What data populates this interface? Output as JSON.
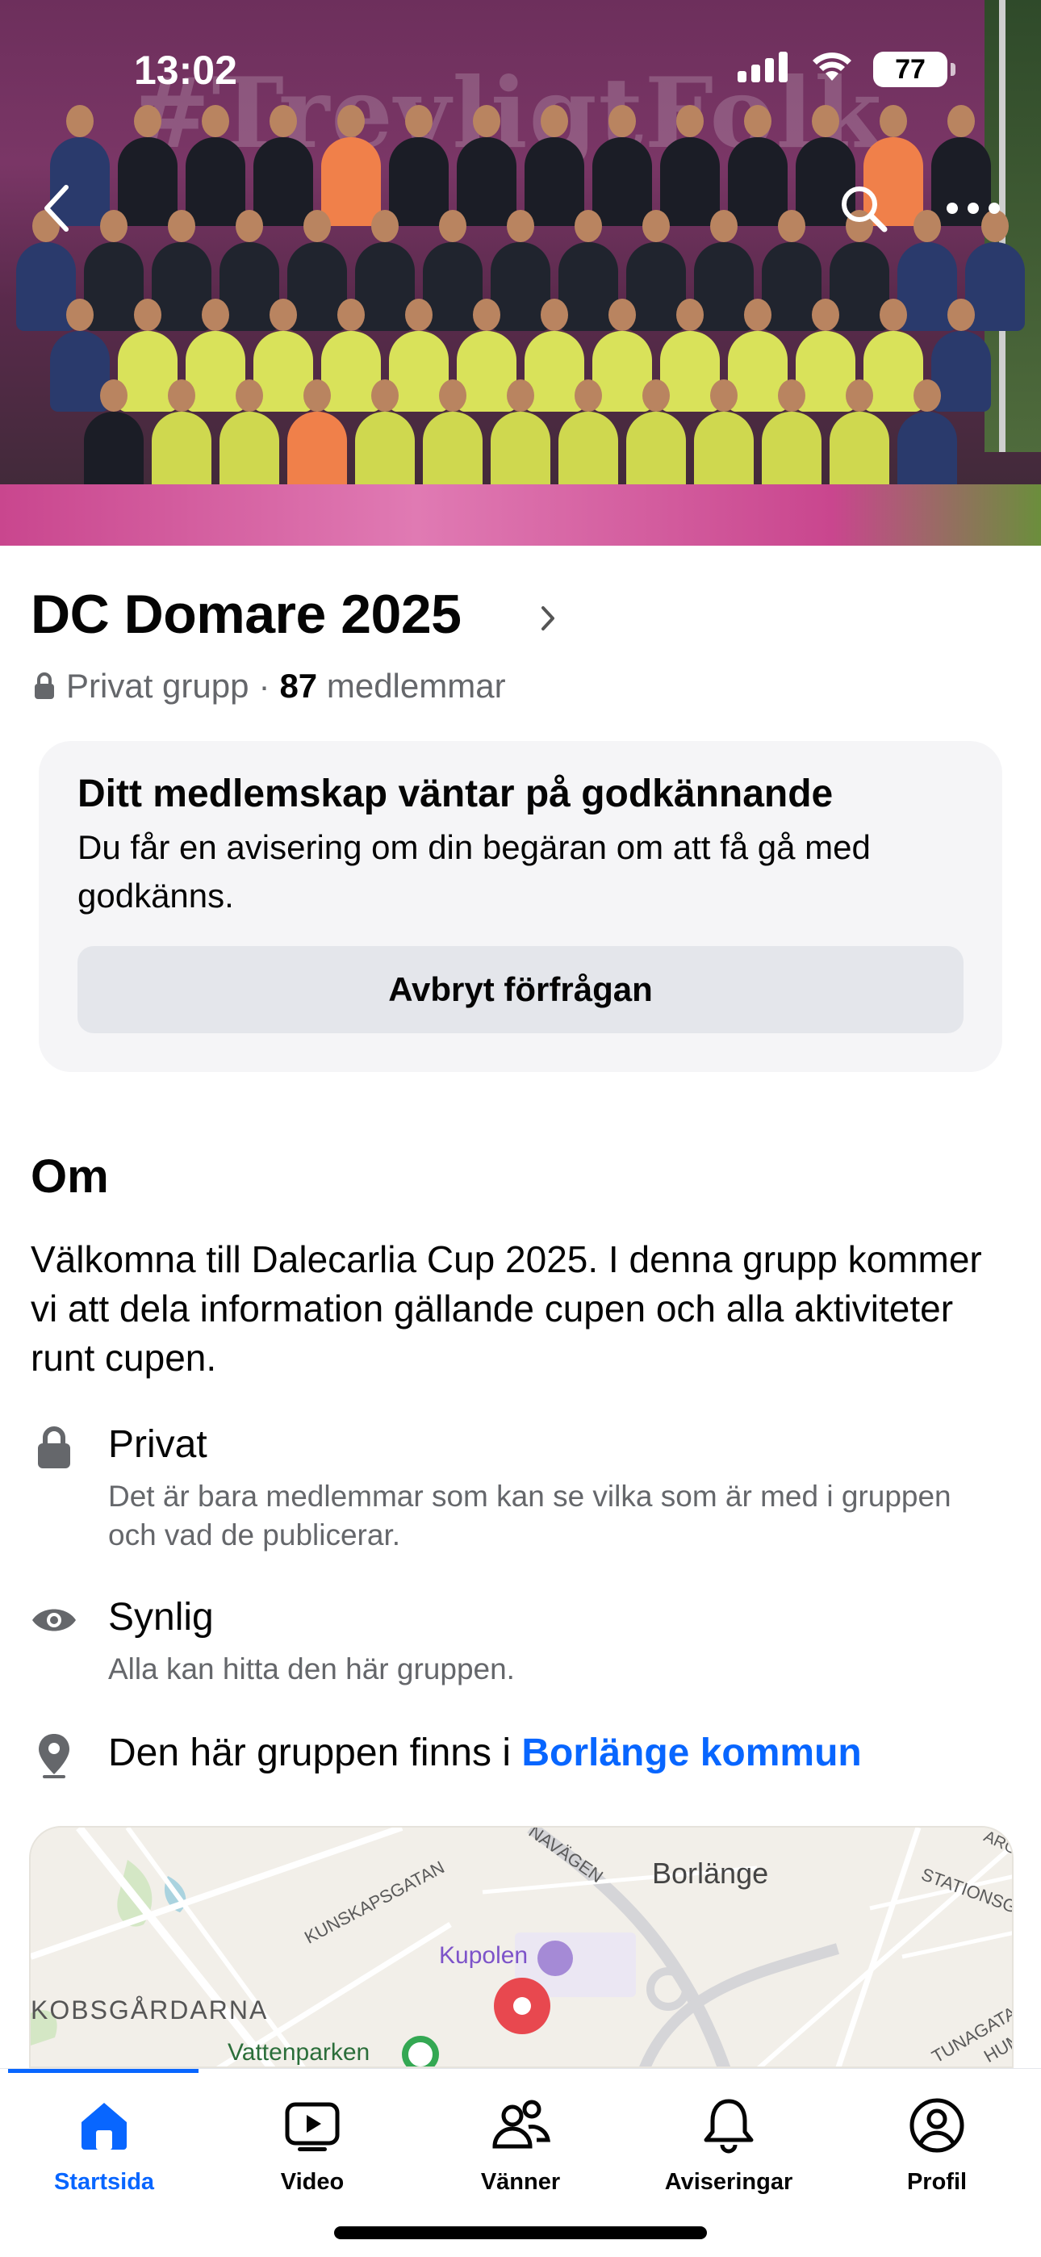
{
  "status_bar": {
    "time": "13:02",
    "battery": "77"
  },
  "cover": {
    "banner_text": "#TrevligtFolk"
  },
  "group": {
    "name": "DC Domare 2025",
    "privacy": "Privat grupp",
    "separator": "·",
    "member_count": "87",
    "member_label": "medlemmar"
  },
  "membership": {
    "title": "Ditt medlemskap väntar på godkännande",
    "text": "Du får en avisering om din begäran om att få gå med godkänns.",
    "cancel_label": "Avbryt förfrågan"
  },
  "about": {
    "heading": "Om",
    "description": "Välkomna till Dalecarlia Cup 2025. I denna grupp kommer vi att dela information gällande cupen och alla aktiviteter runt cupen.",
    "private_title": "Privat",
    "private_text": "Det är bara medlemmar som kan se vilka som är med i gruppen och vad de publicerar.",
    "visible_title": "Synlig",
    "visible_text": "Alla kan hitta den här gruppen.",
    "location_prefix": "Den här gruppen finns i ",
    "location_link": "Borlänge kommun"
  },
  "map": {
    "labels": {
      "city": "Borlänge",
      "road1": "NAVÄGEN",
      "road2": "KUNSKAPSGATAN",
      "road3": "STATIONSGAT",
      "road4": "TUNAGATAN",
      "road5": "HUM",
      "road6": "ARG",
      "poi1": "Kupolen",
      "district": "KOBSGÅRDARNA",
      "poi2": "Vattenparken"
    }
  },
  "tabs": [
    {
      "label": "Startsida",
      "icon": "home-icon",
      "active": true
    },
    {
      "label": "Video",
      "icon": "video-icon",
      "active": false
    },
    {
      "label": "Vänner",
      "icon": "friends-icon",
      "active": false
    },
    {
      "label": "Aviseringar",
      "icon": "bell-icon",
      "active": false
    },
    {
      "label": "Profil",
      "icon": "profile-icon",
      "active": false
    }
  ],
  "colors": {
    "accent": "#0866ff",
    "secondary_text": "#65676b",
    "card_bg": "#f5f5f7",
    "button_bg": "#e4e6eb"
  }
}
